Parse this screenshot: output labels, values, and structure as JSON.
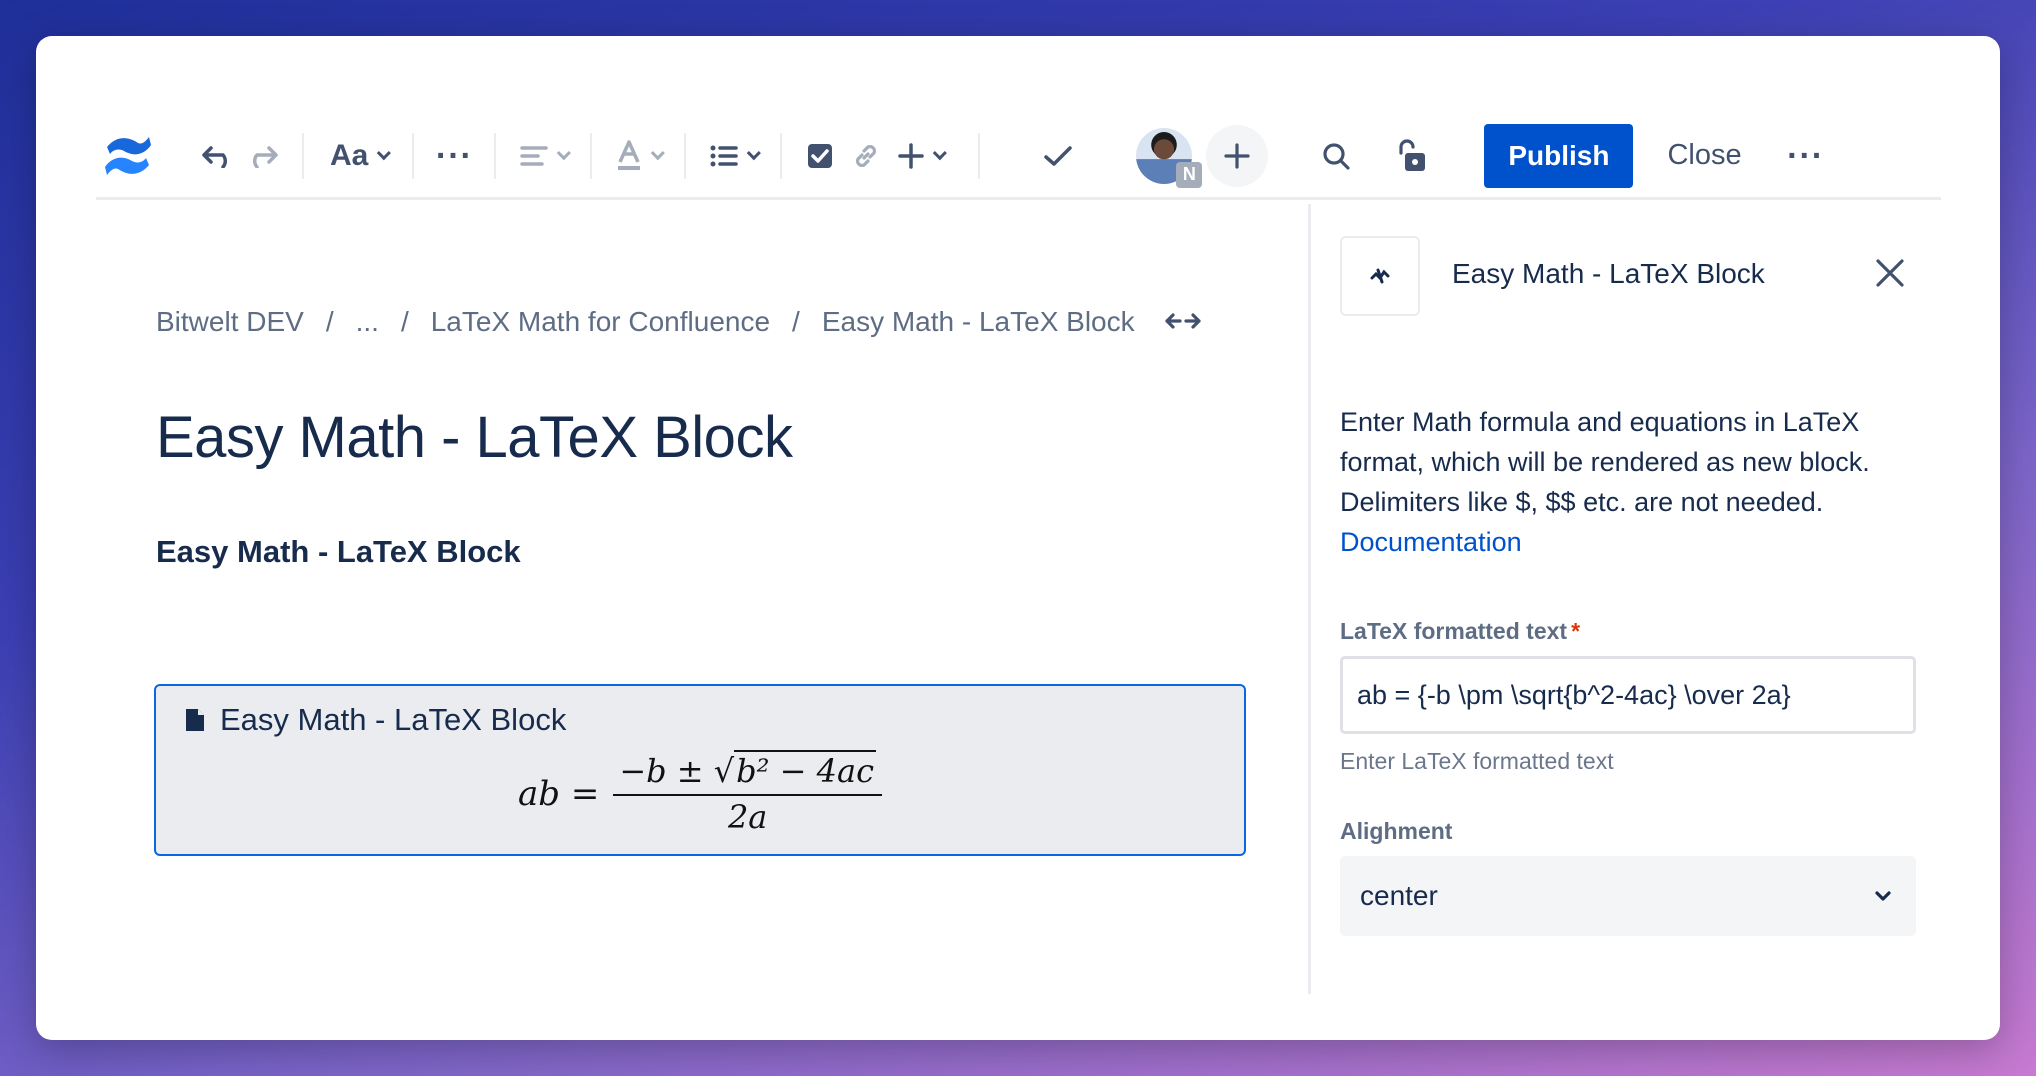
{
  "toolbar": {
    "text_style_label": "Aa",
    "publish_label": "Publish",
    "close_label": "Close",
    "avatar_badge": "N"
  },
  "breadcrumb": {
    "items": [
      "Bitwelt DEV",
      "...",
      "LaTeX Math for Confluence",
      "Easy Math - LaTeX Block"
    ],
    "separator": "/"
  },
  "page": {
    "title": "Easy Math - LaTeX Block",
    "subheading": "Easy Math - LaTeX Block"
  },
  "macro": {
    "title": "Easy Math - LaTeX Block",
    "formula": {
      "lhs": "ab =",
      "numerator_prefix": "−b ± ",
      "radical": "√",
      "radicand": "b² − 4ac",
      "denominator": "2a"
    }
  },
  "panel": {
    "title": "Easy Math - LaTeX Block",
    "description": "Enter Math formula and equations in LaTeX format, which will be rendered as new block. Delimiters like $, $$ etc. are not needed.",
    "doc_link": "Documentation",
    "latex_label": "LaTeX formatted text",
    "required_mark": "*",
    "latex_value": "ab = {-b \\pm \\sqrt{b^2-4ac} \\over 2a}",
    "latex_helper": "Enter LaTeX formatted text",
    "alignment_label": "Alighment",
    "alignment_value": "center"
  },
  "colors": {
    "primary": "#0052cc",
    "macro_border": "#0c66e4",
    "text": "#172b4d"
  }
}
